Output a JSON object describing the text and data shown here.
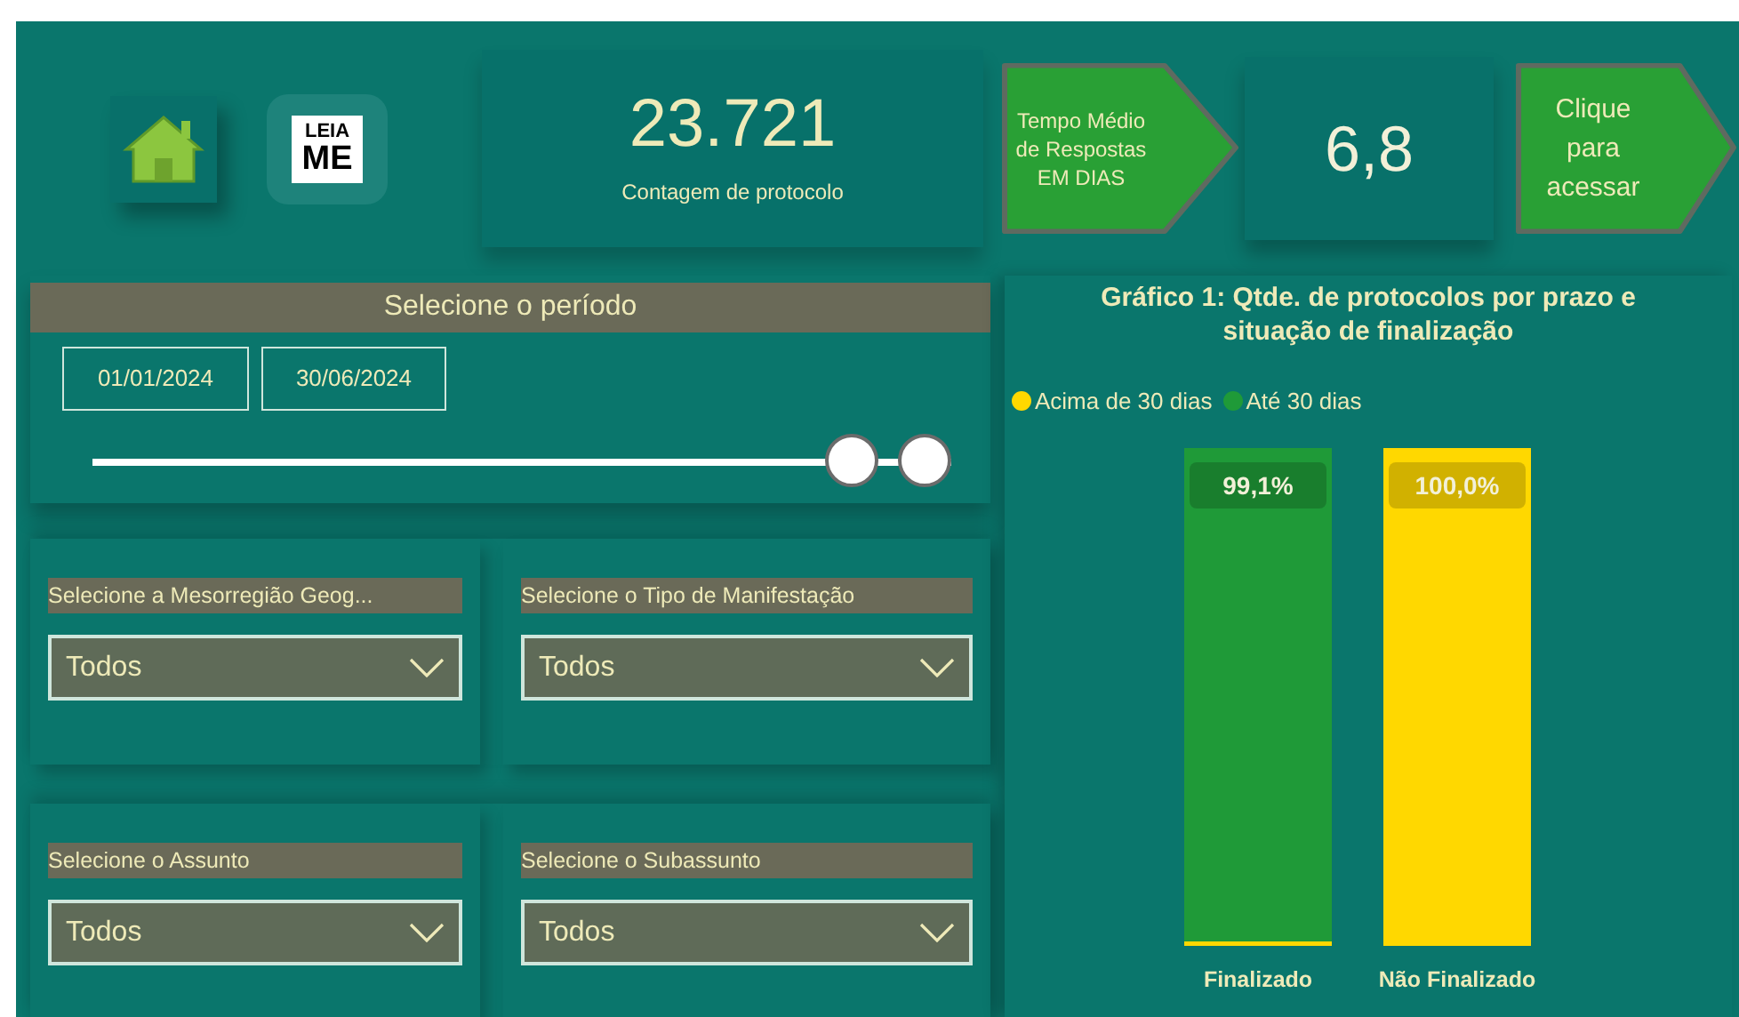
{
  "header": {
    "home_button": {
      "kind": "home"
    },
    "readme_button": {
      "lines": [
        "LEIA",
        "ME"
      ]
    },
    "kpi_protocols": {
      "value": "23.721",
      "label": "Contagem de protocolo"
    },
    "avg_time": {
      "label": "Tempo Médio de Respostas EM DIAS",
      "value": "6,8"
    },
    "access_button": {
      "label": "Clique para acessar"
    }
  },
  "period": {
    "title": "Selecione o período",
    "start": "01/01/2024",
    "end": "30/06/2024",
    "thumbs": [
      {
        "level": 0.91
      },
      {
        "level": 1.0
      }
    ]
  },
  "filters": [
    {
      "label": "Selecione a Mesorregião Geog...",
      "value": "Todos"
    },
    {
      "label": "Selecione o Tipo de Manifestação",
      "value": "Todos"
    },
    {
      "label": "Selecione o Assunto",
      "value": "Todos"
    },
    {
      "label": "Selecione o Subassunto",
      "value": "Todos"
    }
  ],
  "chart": {
    "chart_data": {
      "type": "bar",
      "title": "Gráfico 1: Qtde. de protocolos por prazo e situação de finalização",
      "categories": [
        "Finalizado",
        "Não Finalizado"
      ],
      "stacked": true,
      "legend": "top-left",
      "series": [
        {
          "name": "Acima de 30 dias",
          "color": "#ffd800",
          "values": [
            0.9,
            100.0
          ],
          "value_labels": [
            null,
            "100,0%"
          ]
        },
        {
          "name": "Até 30 dias",
          "color": "#1f9a38",
          "values": [
            99.1,
            0
          ],
          "value_labels": [
            "99,1%",
            null
          ]
        }
      ]
    }
  }
}
